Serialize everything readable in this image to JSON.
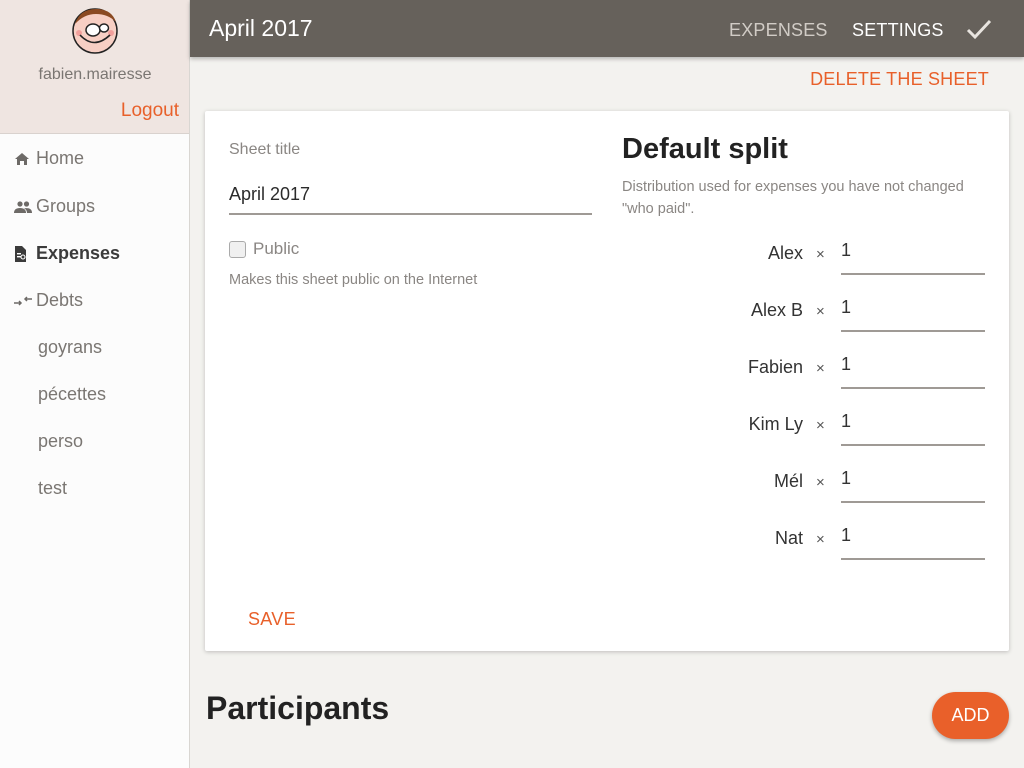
{
  "sidebar": {
    "username": "fabien.mairesse",
    "logout_label": "Logout",
    "items": [
      {
        "label": "Home",
        "icon": "home-icon"
      },
      {
        "label": "Groups",
        "icon": "groups-icon"
      },
      {
        "label": "Expenses",
        "icon": "expenses-icon",
        "active": true
      },
      {
        "label": "Debts",
        "icon": "debts-icon"
      }
    ],
    "groups": [
      "goyrans",
      "pécettes",
      "perso",
      "test"
    ]
  },
  "header": {
    "title": "April 2017",
    "tabs": [
      {
        "label": "EXPENSES",
        "active": false
      },
      {
        "label": "SETTINGS",
        "active": true
      }
    ],
    "confirm_icon": "check-icon"
  },
  "actions": {
    "delete_label": "DELETE THE SHEET"
  },
  "settings": {
    "sheet_title_label": "Sheet title",
    "sheet_title_value": "April 2017",
    "public_label": "Public",
    "public_checked": false,
    "public_help": "Makes this sheet public on the Internet",
    "save_label": "SAVE"
  },
  "default_split": {
    "title": "Default split",
    "description": "Distribution used for expenses you have not changed \"who paid\".",
    "times_symbol": "×",
    "participants": [
      {
        "name": "Alex",
        "weight": "1"
      },
      {
        "name": "Alex B",
        "weight": "1"
      },
      {
        "name": "Fabien",
        "weight": "1"
      },
      {
        "name": "Kim Ly",
        "weight": "1"
      },
      {
        "name": "Mél",
        "weight": "1"
      },
      {
        "name": "Nat",
        "weight": "1"
      }
    ]
  },
  "participants_section": {
    "title": "Participants",
    "add_label": "ADD"
  },
  "colors": {
    "accent": "#e8602a",
    "header_bg": "#66615b",
    "profile_bg": "#efe5e1",
    "page_bg": "#f3f2ef"
  }
}
